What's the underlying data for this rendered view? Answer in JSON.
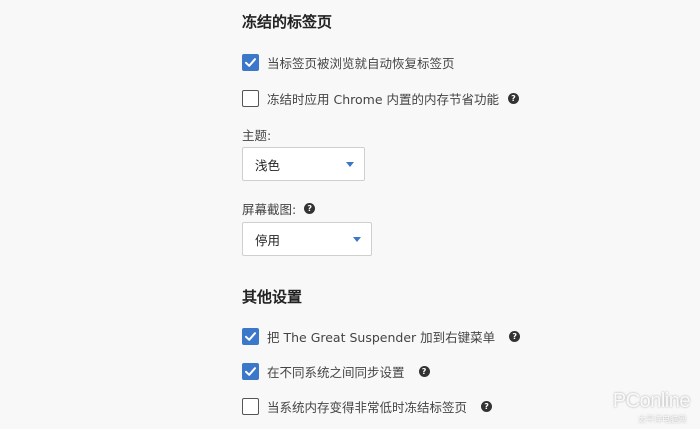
{
  "section_frozen": {
    "title": "冻结的标签页",
    "options": [
      {
        "label": "当标签页被浏览就自动恢复标签页",
        "checked": true,
        "help": false
      },
      {
        "label": "冻结时应用 Chrome 内置的内存节省功能",
        "checked": false,
        "help": true
      }
    ],
    "theme": {
      "label": "主题:",
      "value": "浅色"
    },
    "screenshot": {
      "label": "屏幕截图:",
      "value": "停用",
      "help": true
    }
  },
  "section_other": {
    "title": "其他设置",
    "options": [
      {
        "label": "把 The Great Suspender 加到右键菜单",
        "checked": true,
        "help": true
      },
      {
        "label": "在不同系统之间同步设置",
        "checked": true,
        "help": true
      },
      {
        "label": "当系统内存变得非常低时冻结标签页",
        "checked": false,
        "help": true
      }
    ]
  },
  "help_glyph": "?",
  "check_glyph": "✓",
  "colors": {
    "accent": "#3b78c9",
    "background": "#f8f8f8"
  },
  "watermark": {
    "text": "PConline",
    "sub": "太平洋电脑网"
  }
}
